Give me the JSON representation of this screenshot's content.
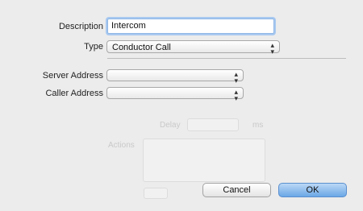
{
  "form": {
    "description_label": "Description",
    "description_value": "Intercom",
    "type_label": "Type",
    "type_value": "Conductor Call",
    "server_address_label": "Server Address",
    "server_address_value": "",
    "caller_address_label": "Caller Address",
    "caller_address_value": ""
  },
  "buttons": {
    "cancel": "Cancel",
    "ok": "OK"
  },
  "background_ghost": {
    "delay_label": "Delay",
    "delay_unit": "ms",
    "actions_label": "Actions"
  },
  "icons": {
    "popup_chevron": "up-down-arrows-icon"
  }
}
